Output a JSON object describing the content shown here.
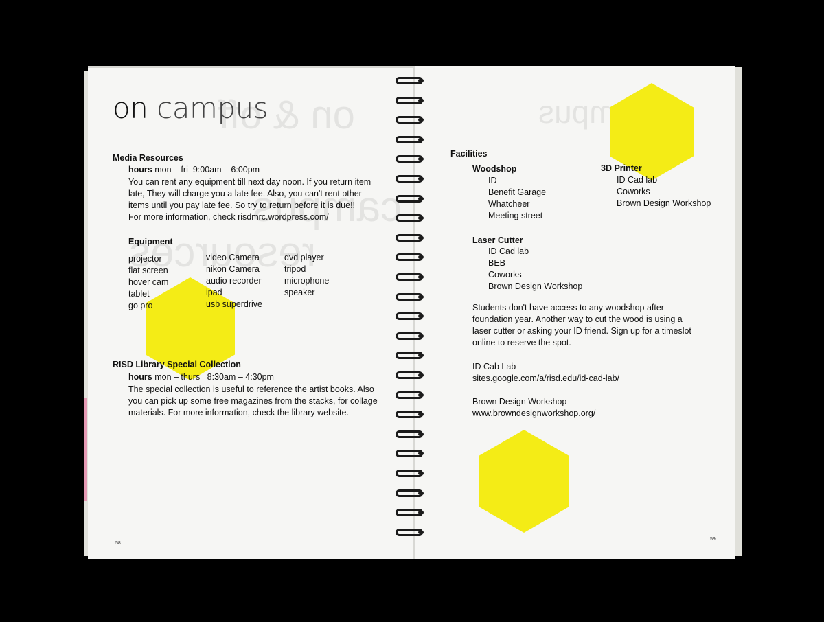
{
  "left": {
    "title_part1": "on",
    "title_part2": "campus",
    "ghost_title": "on & off",
    "ghost_line2": "campus",
    "ghost_line3": "resources",
    "media": {
      "heading": "Media Resources",
      "hours_label": "hours",
      "hours_days": "mon – fri",
      "hours_time": "9:00am – 6:00pm",
      "lines": [
        "You can rent any equipment till next day noon. If you return item",
        "late, They will charge you a late fee. Also, you can't rent other",
        "items until you pay late fee. So try to return before it is due!!",
        "For more information, check risdmrc.wordpress.com/"
      ]
    },
    "equipment": {
      "heading": "Equipment",
      "col1": [
        "projector",
        "flat screen",
        "hover cam",
        "tablet",
        "go pro"
      ],
      "col2": [
        "video Camera",
        "nikon Camera",
        "audio recorder",
        "ipad",
        "usb superdrive"
      ],
      "col3": [
        "dvd player",
        "tripod",
        "microphone",
        "speaker"
      ]
    },
    "library": {
      "heading": "RISD Library Special Collection",
      "hours_label": "hours",
      "hours_days": "mon – thurs",
      "hours_time": "8:30am – 4:30pm",
      "lines": [
        "The special collection is useful to reference the artist books. Also",
        "you can pick up some free magazines from the stacks, for collage",
        "materials. For more information, check the library website."
      ]
    },
    "page_number": "58"
  },
  "right": {
    "ghost_title": "off campus",
    "facilities_heading": "Facilities",
    "woodshop": {
      "heading": "Woodshop",
      "items": [
        "ID",
        "Benefit Garage",
        "Whatcheer",
        "Meeting street"
      ]
    },
    "printer": {
      "heading": "3D Printer",
      "items": [
        "ID Cad lab",
        "Coworks",
        "Brown Design Workshop"
      ]
    },
    "laser": {
      "heading": "Laser Cutter",
      "items": [
        "ID Cad lab",
        "BEB",
        "Coworks",
        "Brown Design Workshop"
      ]
    },
    "note_lines": [
      "Students don't have access to any woodshop after",
      "foundation year. Another way to cut the wood is using a",
      "laser cutter or asking your ID friend. Sign up for a timeslot",
      "online to reserve the spot."
    ],
    "idcab": {
      "name": "ID Cab Lab",
      "url": "sites.google.com/a/risd.edu/id-cad-lab/"
    },
    "brown": {
      "name": "Brown Design Workshop",
      "url": "www.browndesignworkshop.org/"
    },
    "page_number": "59"
  },
  "colors": {
    "highlight_yellow": "#f4ec16",
    "paper": "#f6f6f4",
    "background": "#000000"
  }
}
